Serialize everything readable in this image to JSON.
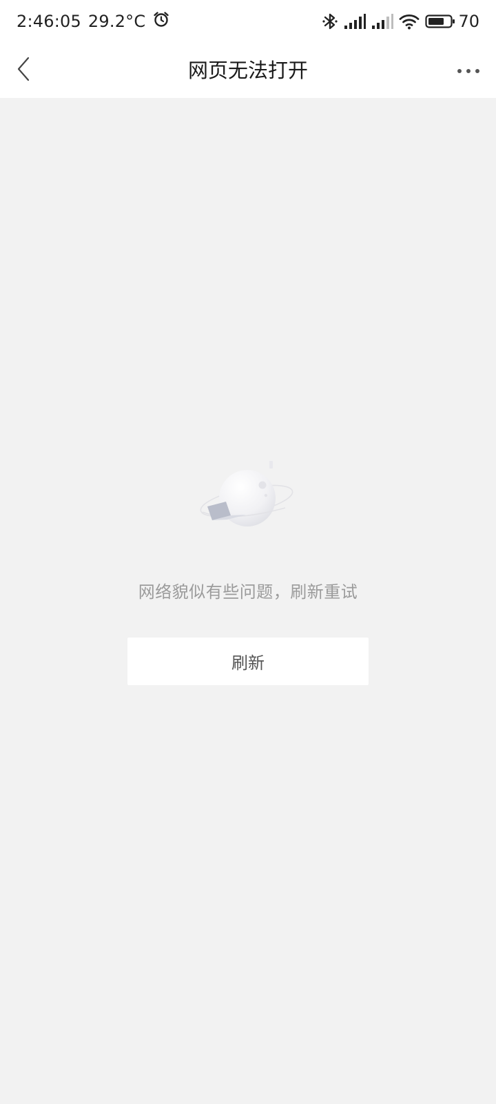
{
  "status_bar": {
    "time": "2:46:05",
    "temperature": "29.2°C",
    "battery_level": "70",
    "icons": {
      "alarm": "alarm-clock-icon",
      "bluetooth": "bluetooth-icon",
      "signal_1": "cellular-signal-icon",
      "signal_2": "cellular-signal-icon",
      "wifi": "wifi-icon",
      "battery": "battery-icon"
    }
  },
  "nav_bar": {
    "title": "网页无法打开",
    "back_icon": "chevron-left-icon",
    "more_icon": "more-horizontal-icon"
  },
  "error": {
    "illustration": "planet-illustration",
    "message": "网络貌似有些问题，刷新重试",
    "refresh_label": "刷新"
  },
  "colors": {
    "background": "#f2f2f2",
    "bar_background": "#ffffff",
    "message_text": "#9b9b9b",
    "button_text": "#555555"
  }
}
